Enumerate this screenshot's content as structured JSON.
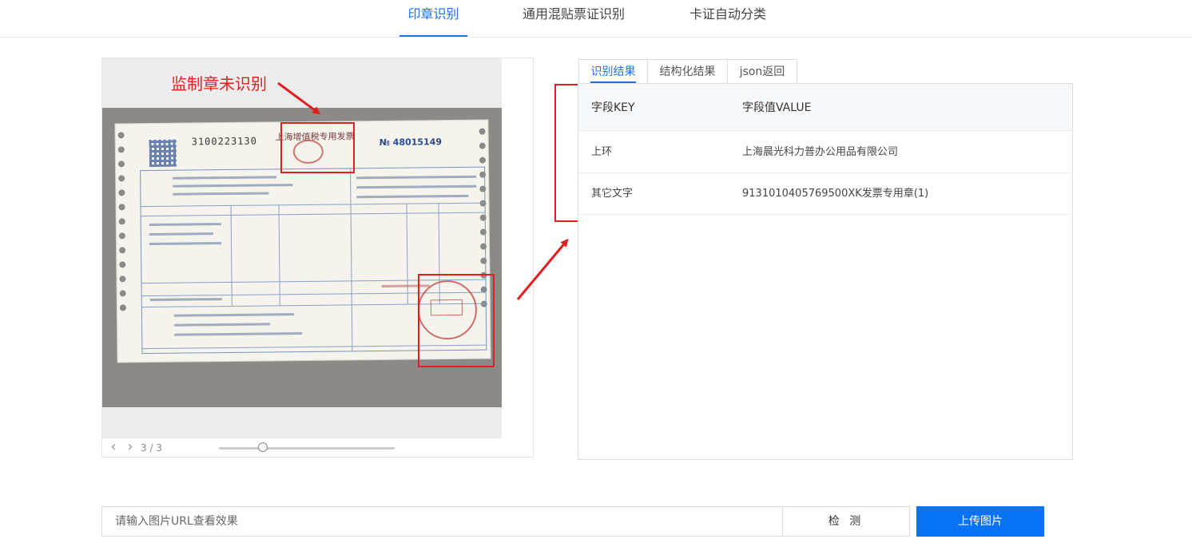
{
  "top_tabs": [
    {
      "label": "印章识别",
      "active": true
    },
    {
      "label": "通用混贴票证识别",
      "active": false
    },
    {
      "label": "卡证自动分类",
      "active": false
    }
  ],
  "image_viewer": {
    "annotation_label": "监制章未识别",
    "page_indicator": "3 / 3",
    "zoom_fraction": 0.25,
    "invoice": {
      "code": "3100223130",
      "title": "上海增值税专用发票",
      "number": "№ 48015149"
    }
  },
  "result_tabs": [
    {
      "label": "识别结果",
      "active": true
    },
    {
      "label": "结构化结果",
      "active": false
    },
    {
      "label": "json返回",
      "active": false
    }
  ],
  "result_table": {
    "header_key": "字段KEY",
    "header_value": "字段值VALUE",
    "rows": [
      {
        "key": "上环",
        "value": "上海晨光科力普办公用品有限公司"
      },
      {
        "key": "其它文字",
        "value": "9131010405769500XK发票专用章(1)"
      }
    ]
  },
  "url_bar": {
    "placeholder": "请输入图片URL查看效果",
    "detect_label": "检 测",
    "upload_label": "上传图片"
  },
  "colors": {
    "accent": "#1a73e8",
    "upload_button": "#0a73f5",
    "annotation_red": "#e02020"
  }
}
